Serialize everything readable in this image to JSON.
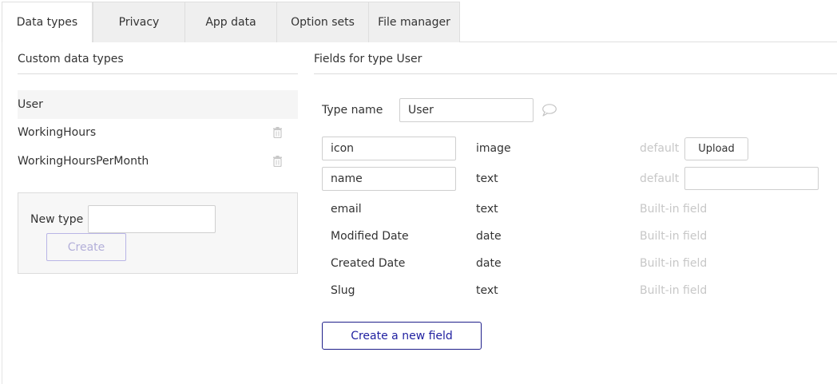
{
  "tabs": [
    {
      "label": "Data types",
      "active": true
    },
    {
      "label": "Privacy",
      "active": false
    },
    {
      "label": "App data",
      "active": false
    },
    {
      "label": "Option sets",
      "active": false
    },
    {
      "label": "File manager",
      "active": false
    }
  ],
  "left": {
    "title": "Custom data types",
    "types": [
      {
        "label": "User",
        "selected": true,
        "deletable": false
      },
      {
        "label": "WorkingHours",
        "selected": false,
        "deletable": true
      },
      {
        "label": "WorkingHoursPerMonth",
        "selected": false,
        "deletable": true
      }
    ],
    "new_type_label": "New type",
    "new_type_value": "",
    "create_label": "Create"
  },
  "right": {
    "title": "Fields for type User",
    "type_name_label": "Type name",
    "type_name_value": "User",
    "fields": [
      {
        "name": "icon",
        "type": "image",
        "extra": "default",
        "editable": true
      },
      {
        "name": "name",
        "type": "text",
        "extra": "default",
        "editable": true
      },
      {
        "name": "email",
        "type": "text",
        "extra": "Built-in field",
        "editable": false
      },
      {
        "name": "Modified Date",
        "type": "date",
        "extra": "Built-in field",
        "editable": false
      },
      {
        "name": "Created Date",
        "type": "date",
        "extra": "Built-in field",
        "editable": false
      },
      {
        "name": "Slug",
        "type": "text",
        "extra": "Built-in field",
        "editable": false
      }
    ],
    "upload_label": "Upload",
    "default_value": "",
    "new_field_label": "Create a new field"
  },
  "colors": {
    "accent": "#1f1fa0",
    "muted_text": "#c7c7c7",
    "tab_inactive_bg": "#efefef"
  }
}
